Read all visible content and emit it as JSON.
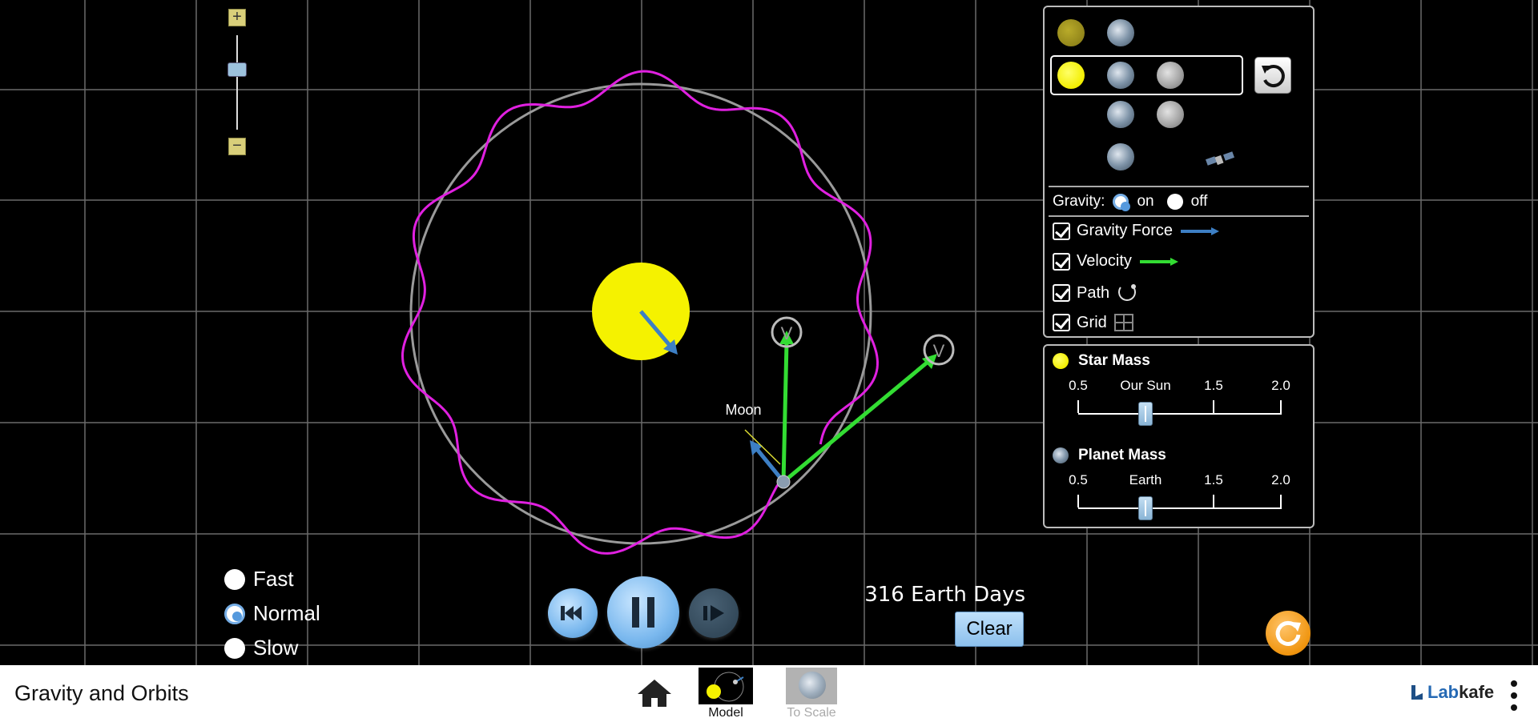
{
  "app": {
    "title": "Gravity and Orbits"
  },
  "scene": {
    "moon_label": "Moon",
    "velocity_marker": "V",
    "days_value": "316",
    "days_unit": "Earth Days",
    "clear_label": "Clear"
  },
  "speed": {
    "options": [
      {
        "label": "Fast",
        "selected": false
      },
      {
        "label": "Normal",
        "selected": true
      },
      {
        "label": "Slow",
        "selected": false
      }
    ]
  },
  "panel": {
    "gravity_label": "Gravity:",
    "gravity_on": "on",
    "gravity_off": "off",
    "gravity_selected": "on",
    "checkboxes": [
      {
        "label": "Gravity Force",
        "checked": true,
        "color": "#3d7fc4"
      },
      {
        "label": "Velocity",
        "checked": true,
        "color": "#33dd33"
      },
      {
        "label": "Path",
        "checked": true
      },
      {
        "label": "Grid",
        "checked": true
      }
    ]
  },
  "mass": {
    "star_title": "Star Mass",
    "planet_title": "Planet Mass",
    "star_ticks": [
      "0.5",
      "Our Sun",
      "1.5",
      "2.0"
    ],
    "planet_ticks": [
      "0.5",
      "Earth",
      "1.5",
      "2.0"
    ],
    "star_value": 1.0,
    "planet_value": 1.0
  },
  "footer": {
    "tabs": [
      {
        "label": "Model",
        "active": true
      },
      {
        "label": "To Scale",
        "active": false
      }
    ],
    "brand_lab": "Lab",
    "brand_kafe": "kafe"
  },
  "colors": {
    "path": "#e020e0",
    "orbit": "#9a9a9a",
    "velocity": "#33dd33",
    "force": "#3d7fc4",
    "accent": "#7ab8ee"
  },
  "icons": [
    "zoom-in-icon",
    "zoom-out-icon",
    "rewind-icon",
    "pause-icon",
    "step-icon",
    "reset-icon",
    "home-icon",
    "menu-icon",
    "satellite-icon"
  ]
}
